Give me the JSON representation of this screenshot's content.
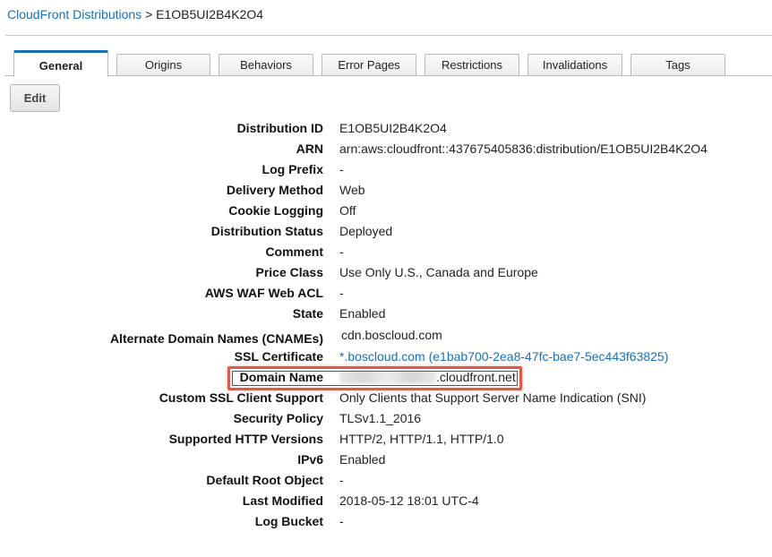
{
  "breadcrumb": {
    "parent": "CloudFront Distributions",
    "separator": ">",
    "current": "E1OB5UI2B4K2O4"
  },
  "tabs": [
    {
      "label": "General",
      "active": true
    },
    {
      "label": "Origins"
    },
    {
      "label": "Behaviors"
    },
    {
      "label": "Error Pages"
    },
    {
      "label": "Restrictions"
    },
    {
      "label": "Invalidations"
    },
    {
      "label": "Tags"
    }
  ],
  "toolbar": {
    "edit_label": "Edit"
  },
  "details": [
    {
      "label": "Distribution ID",
      "value": "E1OB5UI2B4K2O4"
    },
    {
      "label": "ARN",
      "value": "arn:aws:cloudfront::437675405836:distribution/E1OB5UI2B4K2O4"
    },
    {
      "label": "Log Prefix",
      "value": "-"
    },
    {
      "label": "Delivery Method",
      "value": "Web"
    },
    {
      "label": "Cookie Logging",
      "value": "Off"
    },
    {
      "label": "Distribution Status",
      "value": "Deployed"
    },
    {
      "label": "Comment",
      "value": "-"
    },
    {
      "label": "Price Class",
      "value": "Use Only U.S., Canada and Europe"
    },
    {
      "label": "AWS WAF Web ACL",
      "value": "-"
    },
    {
      "label": "State",
      "value": "Enabled"
    },
    {
      "label": "Alternate Domain Names (CNAMEs)",
      "value": "cdn.boscloud.com"
    },
    {
      "label": "SSL Certificate",
      "value": "*.boscloud.com (e1bab700-2ea8-47fc-bae7-5ec443f63825)"
    },
    {
      "label": "Domain Name",
      "value": ".cloudfront.net"
    },
    {
      "label": "Custom SSL Client Support",
      "value": "Only Clients that Support Server Name Indication (SNI)"
    },
    {
      "label": "Security Policy",
      "value": "TLSv1.1_2016"
    },
    {
      "label": "Supported HTTP Versions",
      "value": "HTTP/2, HTTP/1.1, HTTP/1.0"
    },
    {
      "label": "IPv6",
      "value": "Enabled"
    },
    {
      "label": "Default Root Object",
      "value": "-"
    },
    {
      "label": "Last Modified",
      "value": "2018-05-12 18:01 UTC-4"
    },
    {
      "label": "Log Bucket",
      "value": "-"
    }
  ],
  "colors": {
    "link": "#1a6fb5",
    "highlight_border": "#e05a4a"
  }
}
